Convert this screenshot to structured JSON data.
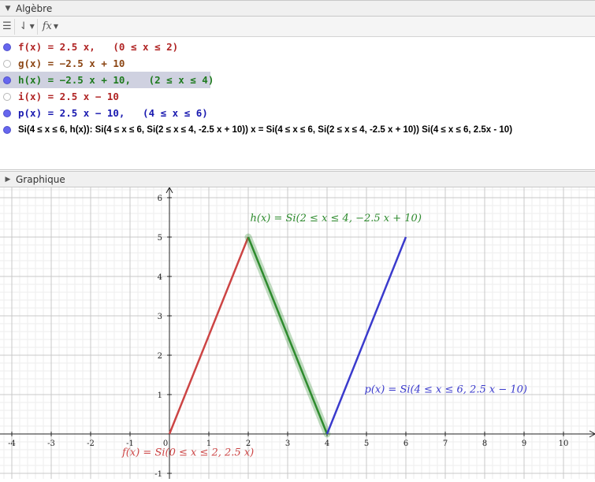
{
  "algebra": {
    "title": "Algèbre",
    "toolbar": {
      "fx_label": "fx"
    },
    "rows": [
      {
        "text": "f(x) = 2.5 x,   (0 ≤ x ≤ 2)",
        "color": "#b02424",
        "visible": true
      },
      {
        "text": "g(x) = −2.5 x + 10",
        "color": "#8b4513",
        "visible": false
      },
      {
        "text": "h(x) = −2.5 x + 10,   (2 ≤ x ≤ 4)",
        "color": "#1e7a1e",
        "visible": true,
        "selected": true
      },
      {
        "text": "i(x) = 2.5 x − 10",
        "color": "#b02424",
        "visible": false
      },
      {
        "text": "p(x) = 2.5 x − 10,   (4 ≤ x ≤ 6)",
        "color": "#1a1ab0",
        "visible": true
      },
      {
        "text": "Si(4 ≤ x ≤ 6, h(x)): Si(4 ≤ x ≤ 6, Si(2 ≤ x ≤ 4, -2.5 x + 10)) x = Si(4 ≤ x ≤ 6, Si(2 ≤ x ≤ 4, -2.5 x + 10)) Si(4 ≤ x ≤ 6, 2.5x - 10)",
        "color": "#000000",
        "visible": true,
        "small": true
      }
    ]
  },
  "graphics": {
    "title": "Graphique",
    "x_ticks": [
      "-4",
      "-3",
      "-2",
      "-1",
      "0",
      "1",
      "2",
      "3",
      "4",
      "5",
      "6",
      "7",
      "8",
      "9",
      "10"
    ],
    "y_ticks": [
      "-1",
      "1",
      "2",
      "3",
      "4",
      "5",
      "6"
    ],
    "curves": [
      {
        "name": "f",
        "color": "#cc4444",
        "points": [
          [
            0,
            0
          ],
          [
            2,
            5
          ]
        ],
        "label": "f(x)  =  Si(0 ≤ x ≤ 2, 2.5 x)",
        "label_at": [
          -1.2,
          -0.55
        ]
      },
      {
        "name": "h",
        "color": "#2e8b2e",
        "points": [
          [
            2,
            5
          ],
          [
            4,
            0
          ]
        ],
        "label": "h(x)  =  Si(2 ≤ x ≤ 4, −2.5 x + 10)",
        "label_at": [
          2.05,
          5.4
        ],
        "highlight": true
      },
      {
        "name": "p",
        "color": "#3a3acc",
        "points": [
          [
            4,
            0
          ],
          [
            6,
            5
          ]
        ],
        "label": "p(x)  =  Si(4 ≤ x ≤ 6, 2.5 x − 10)",
        "label_at": [
          4.95,
          1.05
        ]
      }
    ]
  }
}
